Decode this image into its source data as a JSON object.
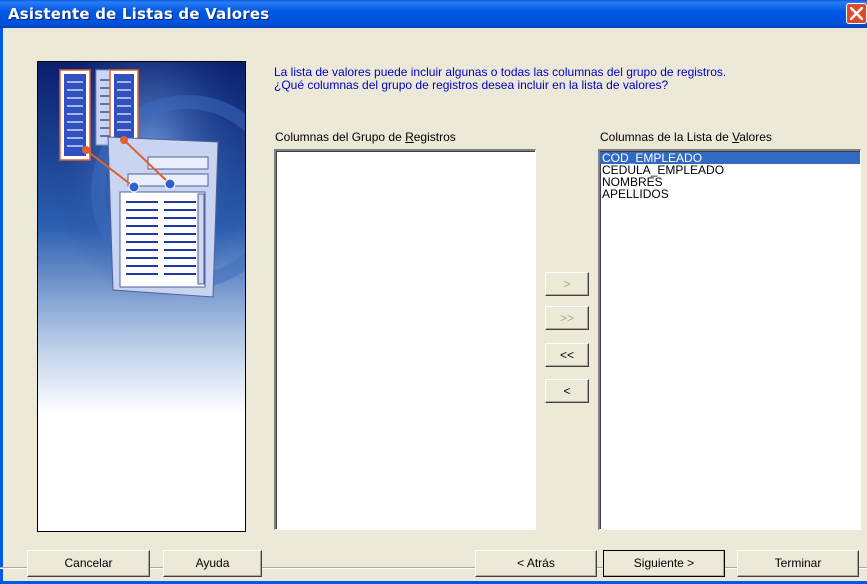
{
  "window": {
    "title": "Asistente de Listas de Valores"
  },
  "instructions": {
    "line1": "La lista de valores puede incluir algunas o todas las columnas del grupo de registros.",
    "line2": "¿Qué columnas del grupo de registros desea incluir en la lista de valores?"
  },
  "left_list": {
    "label_pre": "Columnas del Grupo de ",
    "label_mnemonic": "R",
    "label_post": "egistros",
    "items": []
  },
  "right_list": {
    "label_pre": "Columnas de la Lista de ",
    "label_mnemonic": "V",
    "label_post": "alores",
    "items": [
      "COD_EMPLEADO",
      "CEDULA_EMPLEADO",
      "NOMBRES",
      "APELLIDOS"
    ],
    "selected": "COD_EMPLEADO"
  },
  "move_buttons": {
    "add_one": ">",
    "add_all": ">>",
    "remove_all": "<<",
    "remove_one": "<"
  },
  "footer": {
    "cancel": "Cancelar",
    "help": "Ayuda",
    "back": "< Atrás",
    "next": "Siguiente >",
    "finish": "Terminar"
  },
  "colors": {
    "titlebar": "#0058e6",
    "selection": "#316ac5",
    "instruction_text": "#0000c8"
  }
}
